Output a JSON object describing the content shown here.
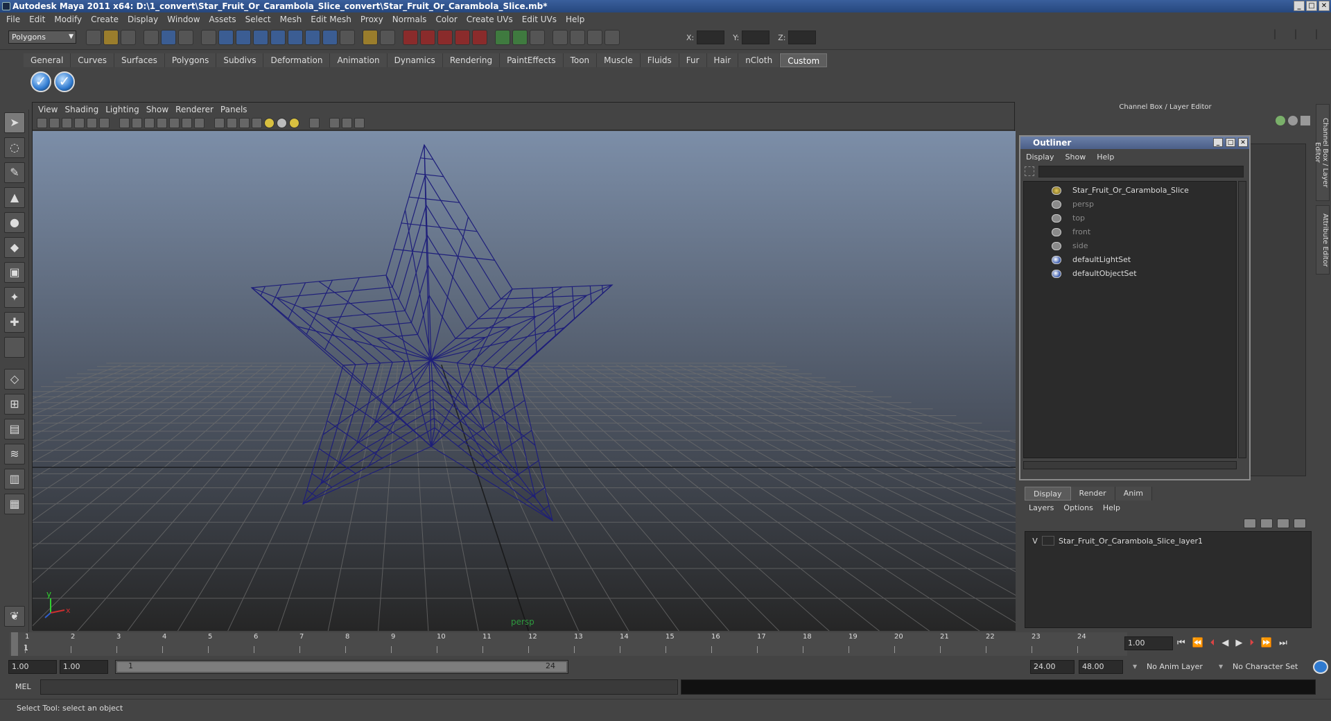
{
  "window": {
    "title": "Autodesk Maya 2011 x64: D:\\1_convert\\Star_Fruit_Or_Carambola_Slice_convert\\Star_Fruit_Or_Carambola_Slice.mb*"
  },
  "menubar": [
    "File",
    "Edit",
    "Modify",
    "Create",
    "Display",
    "Window",
    "Assets",
    "Select",
    "Mesh",
    "Edit Mesh",
    "Proxy",
    "Normals",
    "Color",
    "Create UVs",
    "Edit UVs",
    "Help"
  ],
  "toolbar": {
    "mode": "Polygons",
    "x_label": "X:",
    "y_label": "Y:",
    "z_label": "Z:"
  },
  "shelf_tabs": [
    "General",
    "Curves",
    "Surfaces",
    "Polygons",
    "Subdivs",
    "Deformation",
    "Animation",
    "Dynamics",
    "Rendering",
    "PaintEffects",
    "Toon",
    "Muscle",
    "Fluids",
    "Fur",
    "Hair",
    "nCloth",
    "Custom"
  ],
  "shelf_active": "Custom",
  "viewport": {
    "menu": [
      "View",
      "Shading",
      "Lighting",
      "Show",
      "Renderer",
      "Panels"
    ],
    "camera_label": "persp",
    "axis_y": "y",
    "axis_x": "x"
  },
  "channel_box": {
    "title": "Channel Box / Layer Editor"
  },
  "outliner": {
    "title": "Outliner",
    "menu": [
      "Display",
      "Show",
      "Help"
    ],
    "items": [
      {
        "label": "Star_Fruit_Or_Carambola_Slice",
        "icon": "mesh-icon",
        "dim": false
      },
      {
        "label": "persp",
        "icon": "camera-icon",
        "dim": true
      },
      {
        "label": "top",
        "icon": "camera-icon",
        "dim": true
      },
      {
        "label": "front",
        "icon": "camera-icon",
        "dim": true
      },
      {
        "label": "side",
        "icon": "camera-icon",
        "dim": true
      },
      {
        "label": "defaultLightSet",
        "icon": "set-icon",
        "dim": false
      },
      {
        "label": "defaultObjectSet",
        "icon": "set-icon",
        "dim": false
      }
    ]
  },
  "layer_editor": {
    "tabs": [
      "Display",
      "Render",
      "Anim"
    ],
    "active_tab": "Display",
    "menu": [
      "Layers",
      "Options",
      "Help"
    ],
    "layer": {
      "visible": "V",
      "name": "Star_Fruit_Or_Carambola_Slice_layer1"
    }
  },
  "side_tabs": [
    "Channel Box / Layer Editor",
    "Attribute Editor"
  ],
  "timeline": {
    "ticks": [
      "1",
      "2",
      "3",
      "4",
      "5",
      "6",
      "7",
      "8",
      "9",
      "10",
      "11",
      "12",
      "13",
      "14",
      "15",
      "16",
      "17",
      "18",
      "19",
      "20",
      "21",
      "22",
      "23",
      "24"
    ],
    "current_frame_marker": "1",
    "current_time": "1.00"
  },
  "range": {
    "start": "1.00",
    "playback_start": "1.00",
    "bar_start": "1",
    "bar_end": "24",
    "playback_end": "24.00",
    "end": "48.00",
    "anim_layer": "No Anim Layer",
    "character_set": "No Character Set"
  },
  "command": {
    "label": "MEL"
  },
  "status": {
    "help": "Select Tool: select an object"
  },
  "colors": {
    "wire": "#1e1e7a",
    "grid": "#6e6e6e",
    "bg_top": "#7c8ea8",
    "bg_bottom": "#262626"
  }
}
